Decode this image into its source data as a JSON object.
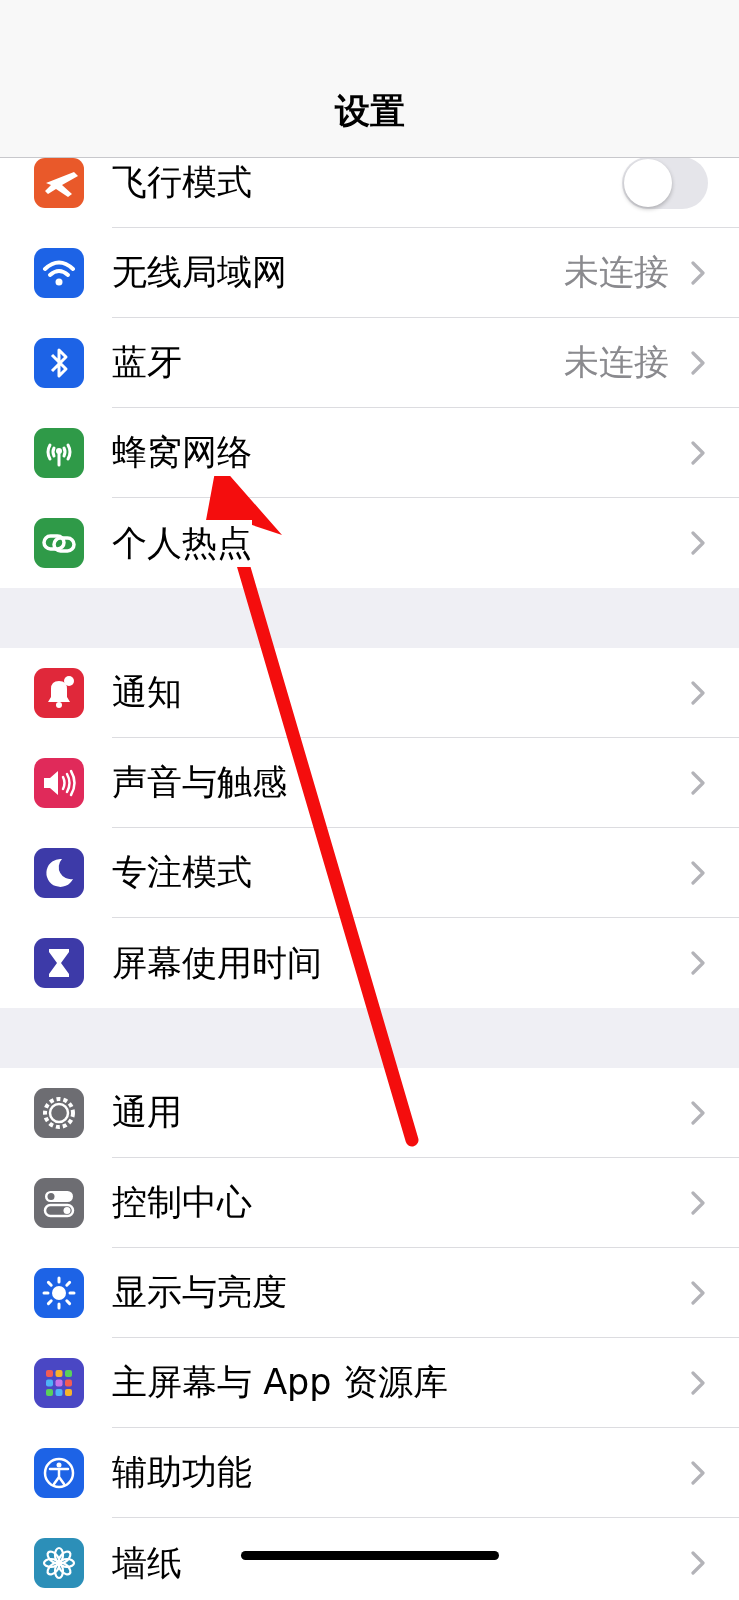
{
  "nav_bar": {
    "title": "设置"
  },
  "groups": [
    {
      "rows": [
        {
          "kind": "toggle",
          "label": "飞行模式",
          "color": "#e9592a",
          "on": false
        },
        {
          "kind": "link",
          "label": "无线局域网",
          "value": "未连接",
          "color": "#1d63e6"
        },
        {
          "kind": "link",
          "label": "蓝牙",
          "value": "未连接",
          "color": "#1d63e6"
        },
        {
          "kind": "link",
          "label": "蜂窝网络",
          "color": "#2f9a48"
        },
        {
          "kind": "link",
          "label": "个人热点",
          "color": "#2f9a48"
        }
      ]
    },
    {
      "rows": [
        {
          "kind": "link",
          "label": "通知",
          "color": "#e0283a"
        },
        {
          "kind": "link",
          "label": "声音与触感",
          "color": "#e02a5a"
        },
        {
          "kind": "link",
          "label": "专注模式",
          "color": "#3d3aa8"
        },
        {
          "kind": "link",
          "label": "屏幕使用时间",
          "color": "#3d3aa8"
        }
      ]
    },
    {
      "rows": [
        {
          "kind": "link",
          "label": "通用",
          "color": "#6d6d72"
        },
        {
          "kind": "link",
          "label": "控制中心",
          "color": "#6d6d72"
        },
        {
          "kind": "link",
          "label": "显示与亮度",
          "color": "#1d63e6"
        },
        {
          "kind": "link",
          "label": "主屏幕与 App 资源库",
          "color": "#4a47c4"
        },
        {
          "kind": "link",
          "label": "辅助功能",
          "color": "#1d63e6"
        },
        {
          "kind": "link",
          "label": "墙纸",
          "color": "#2c8fb8"
        }
      ]
    }
  ]
}
